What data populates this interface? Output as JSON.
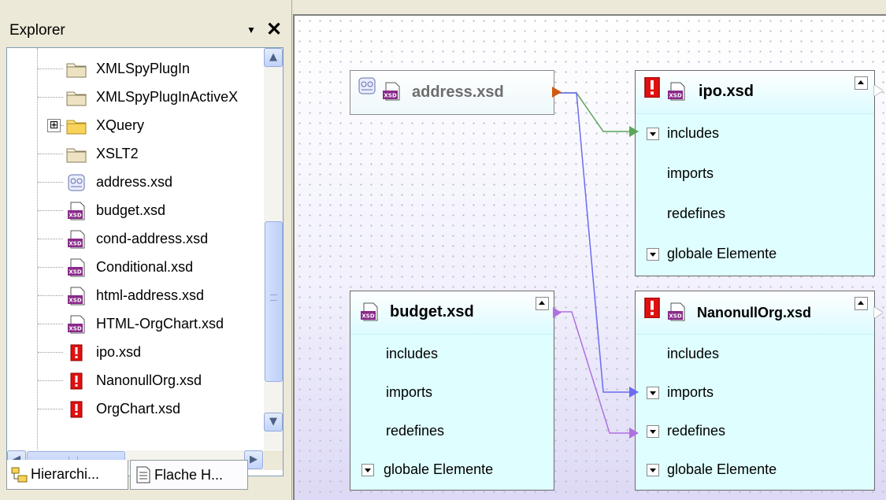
{
  "explorer": {
    "title": "Explorer",
    "pin_icon": "dropdown-arrow-icon",
    "close_icon": "close-icon",
    "tree": [
      {
        "label": "XMLSpyPlugIn",
        "icon": "folder-icon"
      },
      {
        "label": "XMLSpyPlugInActiveX",
        "icon": "folder-icon"
      },
      {
        "label": "XQuery",
        "icon": "folder-icon",
        "expander": "⊞"
      },
      {
        "label": "XSLT2",
        "icon": "folder-icon"
      },
      {
        "label": "address.xsd",
        "icon": "chameleon-schema-icon"
      },
      {
        "label": "budget.xsd",
        "icon": "xsd-file-icon"
      },
      {
        "label": "cond-address.xsd",
        "icon": "xsd-file-icon"
      },
      {
        "label": "Conditional.xsd",
        "icon": "xsd-file-icon"
      },
      {
        "label": "html-address.xsd",
        "icon": "xsd-file-icon"
      },
      {
        "label": "HTML-OrgChart.xsd",
        "icon": "xsd-file-icon"
      },
      {
        "label": "ipo.xsd",
        "icon": "error-icon"
      },
      {
        "label": "NanonullOrg.xsd",
        "icon": "error-icon"
      },
      {
        "label": "OrgChart.xsd",
        "icon": "error-icon"
      }
    ],
    "tabs": [
      {
        "label": "Hierarchi...",
        "icon": "hierarchy-icon"
      },
      {
        "label": "Flache H...",
        "icon": "flat-list-icon"
      }
    ]
  },
  "canvas": {
    "nodes": {
      "address": {
        "title": "address.xsd"
      },
      "ipo": {
        "title": "ipo.xsd",
        "rows": [
          "includes",
          "imports",
          "redefines",
          "globale Elemente"
        ]
      },
      "budget": {
        "title": "budget.xsd",
        "rows": [
          "includes",
          "imports",
          "redefines",
          "globale Elemente"
        ]
      },
      "nanonull": {
        "title": "NanonullOrg.xsd",
        "rows": [
          "includes",
          "imports",
          "redefines",
          "globale Elemente"
        ]
      }
    },
    "colors": {
      "include_link": "#5aa65a",
      "import_link": "#6b6bf0",
      "redefine_link": "#b070e0",
      "address_port": "#d05a10",
      "node_fill": "#dffeff"
    }
  }
}
